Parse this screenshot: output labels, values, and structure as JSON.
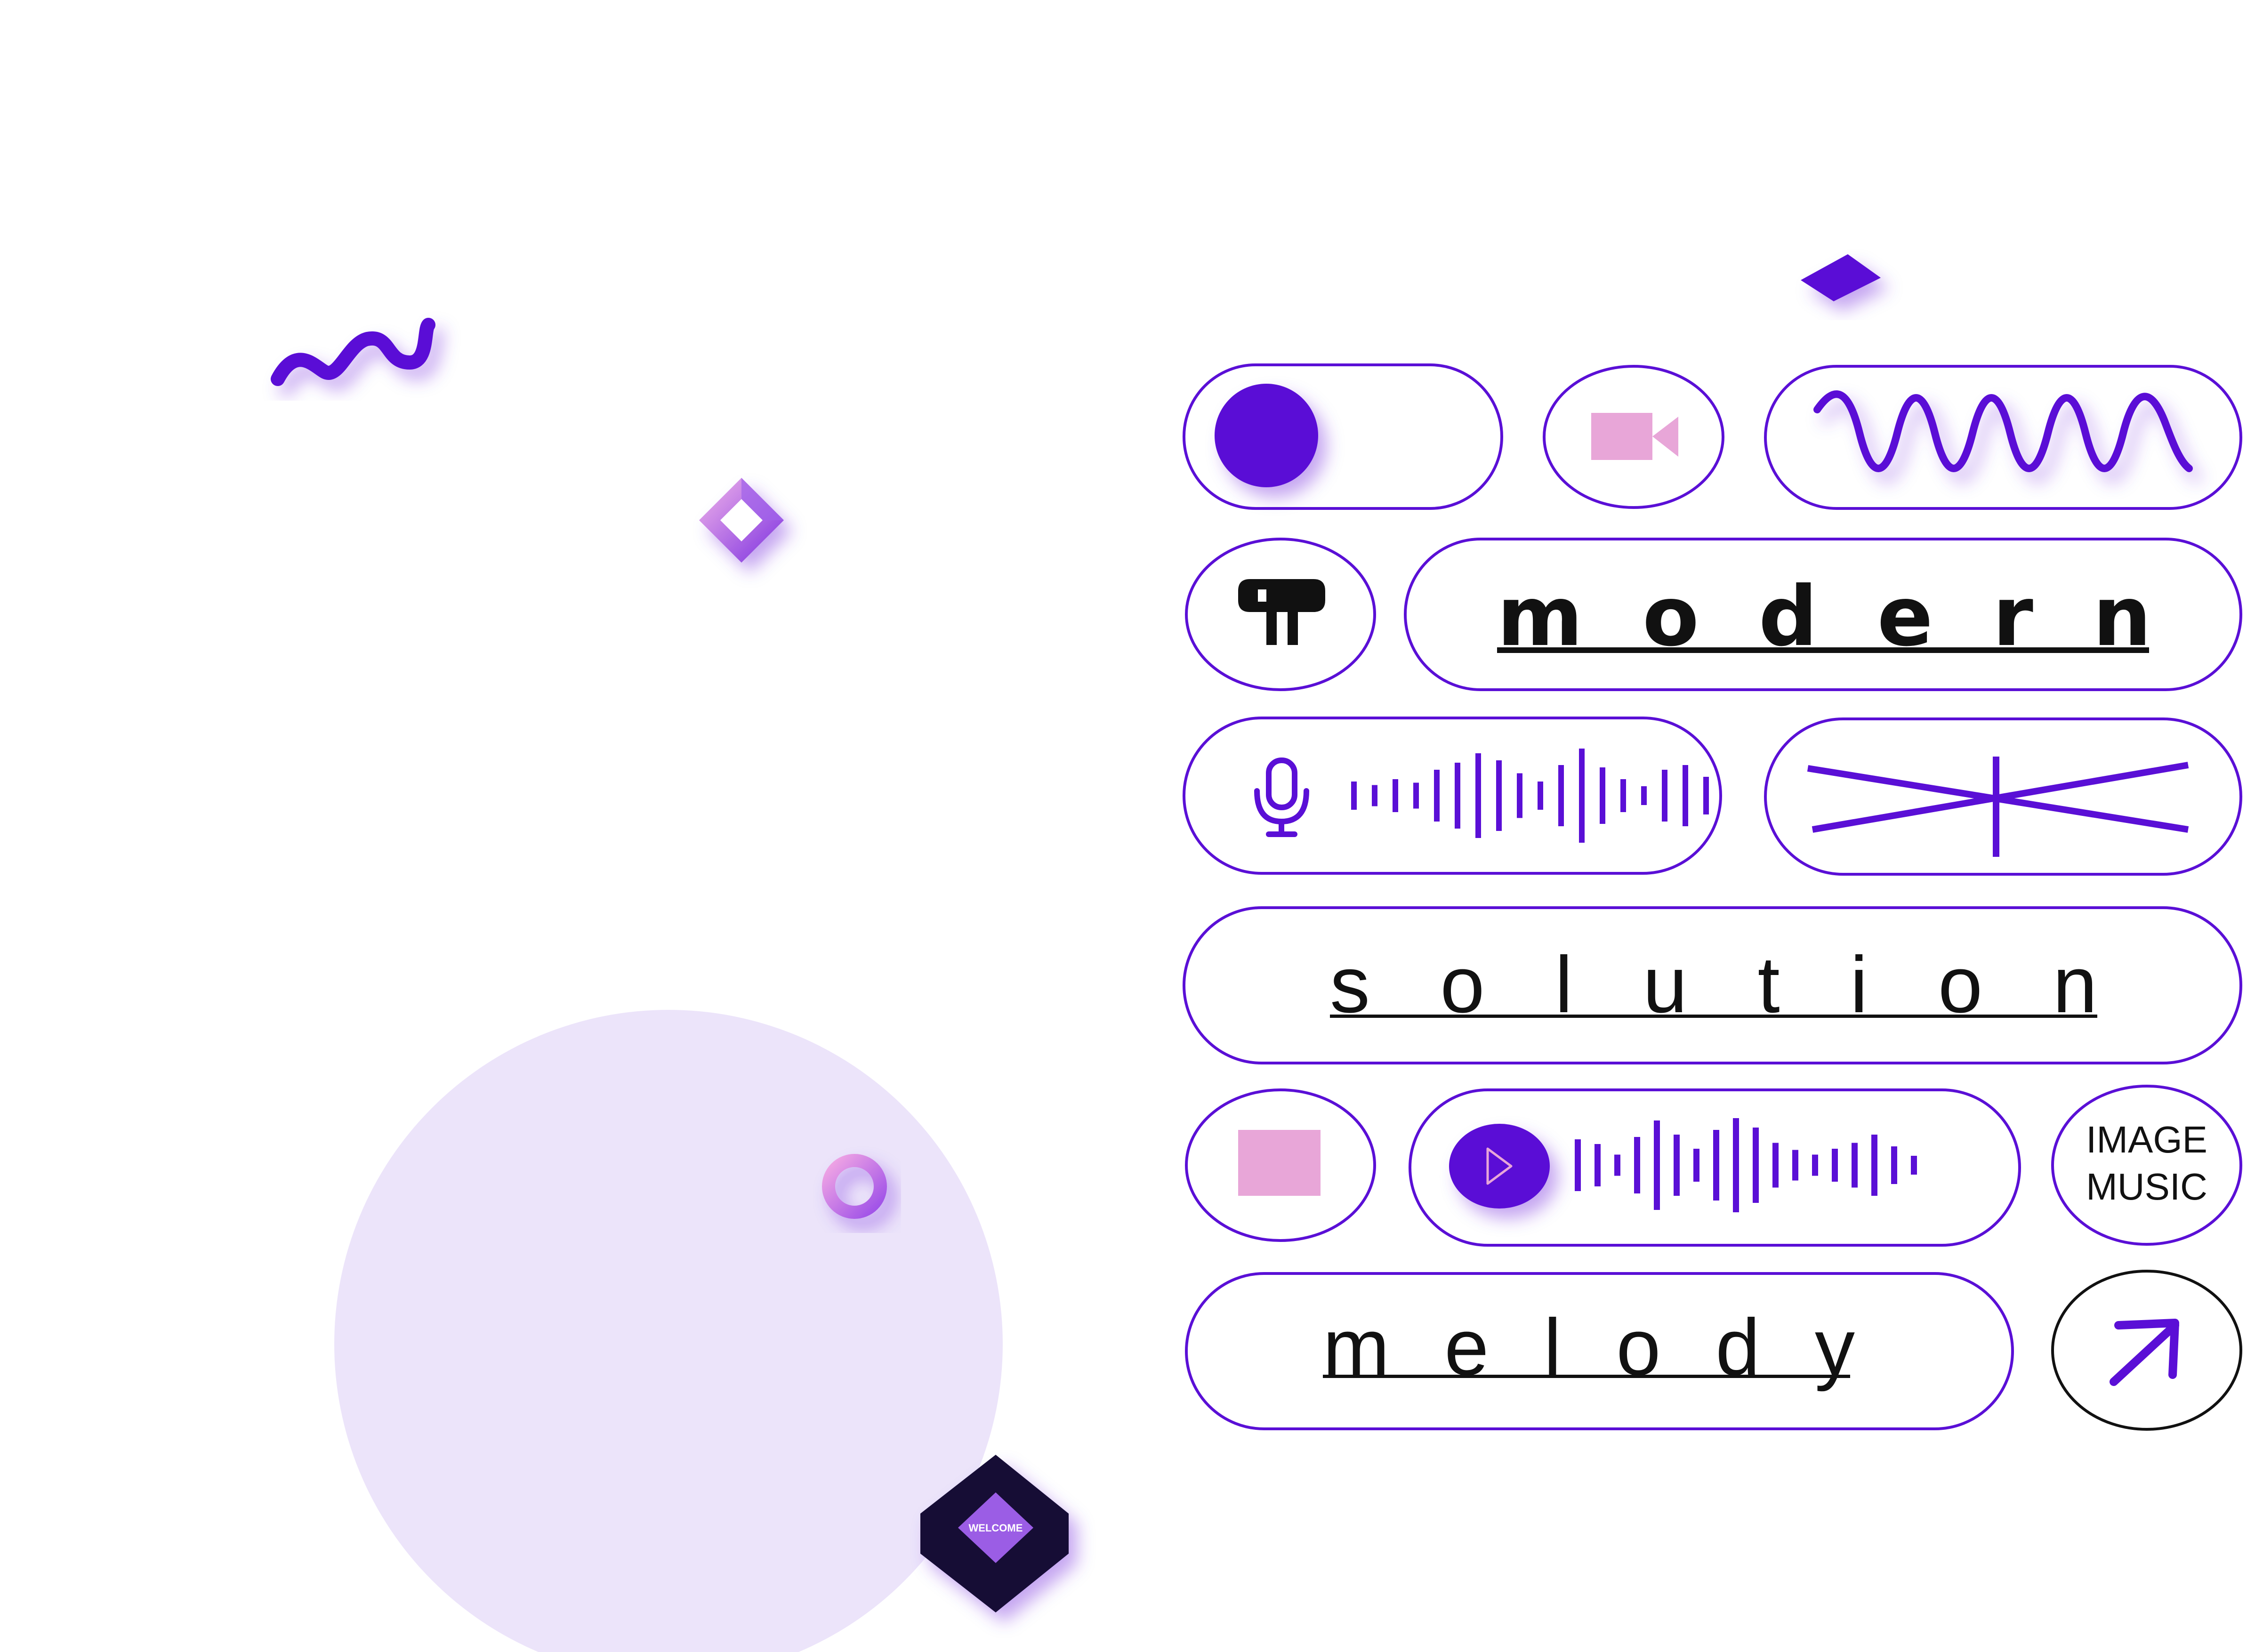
{
  "colors": {
    "accent": "#5a0fd6",
    "pink": "#e8a6d8",
    "lavender": "#ece4fa",
    "navy": "#151035",
    "black": "#111111"
  },
  "words": {
    "modern": "modern",
    "solution": "solution",
    "melody": "melody"
  },
  "badge": {
    "line1": "IMAGE",
    "line2": "MUSIC"
  },
  "welcome": "WELCOME",
  "icons": {
    "toggle": "toggle-switch-icon",
    "camera": "video-camera-icon",
    "wave": "sine-wave-icon",
    "pilcrow": "pilcrow-icon",
    "mic": "microphone-icon",
    "cross": "crossed-lines-icon",
    "stop": "stop-square-icon",
    "play": "play-icon",
    "arrow": "arrow-up-right-icon"
  }
}
